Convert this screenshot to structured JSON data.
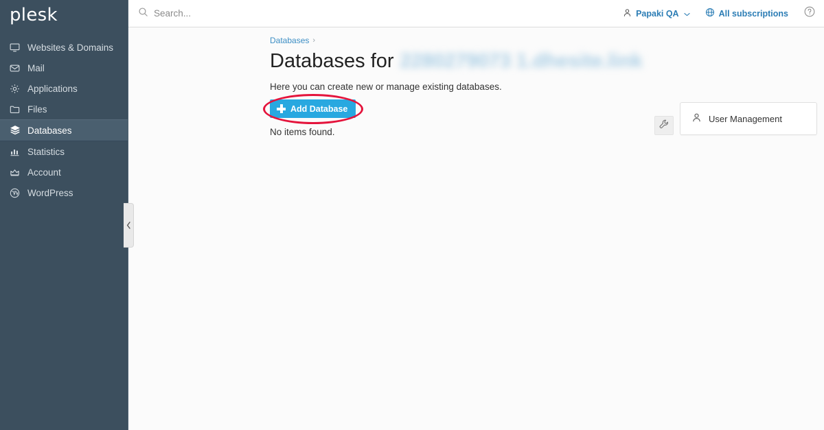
{
  "sidebar": {
    "logo": "plesk",
    "items": [
      {
        "label": "Websites & Domains",
        "icon": "monitor-icon",
        "key": "websites-domains",
        "active": false
      },
      {
        "label": "Mail",
        "icon": "envelope-icon",
        "key": "mail",
        "active": false
      },
      {
        "label": "Applications",
        "icon": "gear-icon",
        "key": "applications",
        "active": false
      },
      {
        "label": "Files",
        "icon": "folder-icon",
        "key": "files",
        "active": false
      },
      {
        "label": "Databases",
        "icon": "layers-icon",
        "key": "databases",
        "active": true
      },
      {
        "label": "Statistics",
        "icon": "bar-chart-icon",
        "key": "statistics",
        "active": false
      },
      {
        "label": "Account",
        "icon": "crown-icon",
        "key": "account",
        "active": false
      },
      {
        "label": "WordPress",
        "icon": "wordpress-icon",
        "key": "wordpress",
        "active": false
      }
    ],
    "collapse_icon": "chevron-left-icon"
  },
  "topbar": {
    "search_placeholder": "Search...",
    "search_icon": "search-icon",
    "user": {
      "label": "Papaki QA",
      "icon": "user-icon",
      "chevron": "chevron-down-icon"
    },
    "subscriptions": {
      "label": "All subscriptions",
      "icon": "globe-icon"
    },
    "help_icon": "help-circle-icon"
  },
  "breadcrumb": {
    "items": [
      "Databases"
    ],
    "separator": "›"
  },
  "page": {
    "title_prefix": "Databases for",
    "title_domain": "2280279073 1.dhesite.link",
    "description": "Here you can create new or manage existing databases.",
    "empty_message": "No items found."
  },
  "actions": {
    "add_database": {
      "label": "Add Database",
      "icon": "plus-icon"
    },
    "tool_button": {
      "icon": "wrench-icon"
    }
  },
  "right_panel": {
    "card": {
      "item_label": "User Management",
      "item_icon": "user-icon"
    }
  },
  "colors": {
    "sidebar_bg": "#3c4f5e",
    "sidebar_active_bg": "#4a5f6f",
    "accent_blue": "#28a8e0",
    "link_blue": "#3c8ec4",
    "topbar_link": "#2c7db5",
    "annotation_red": "#e4143c",
    "logo_underline": "#5fc8e8",
    "content_bg": "#fbfbfb"
  }
}
